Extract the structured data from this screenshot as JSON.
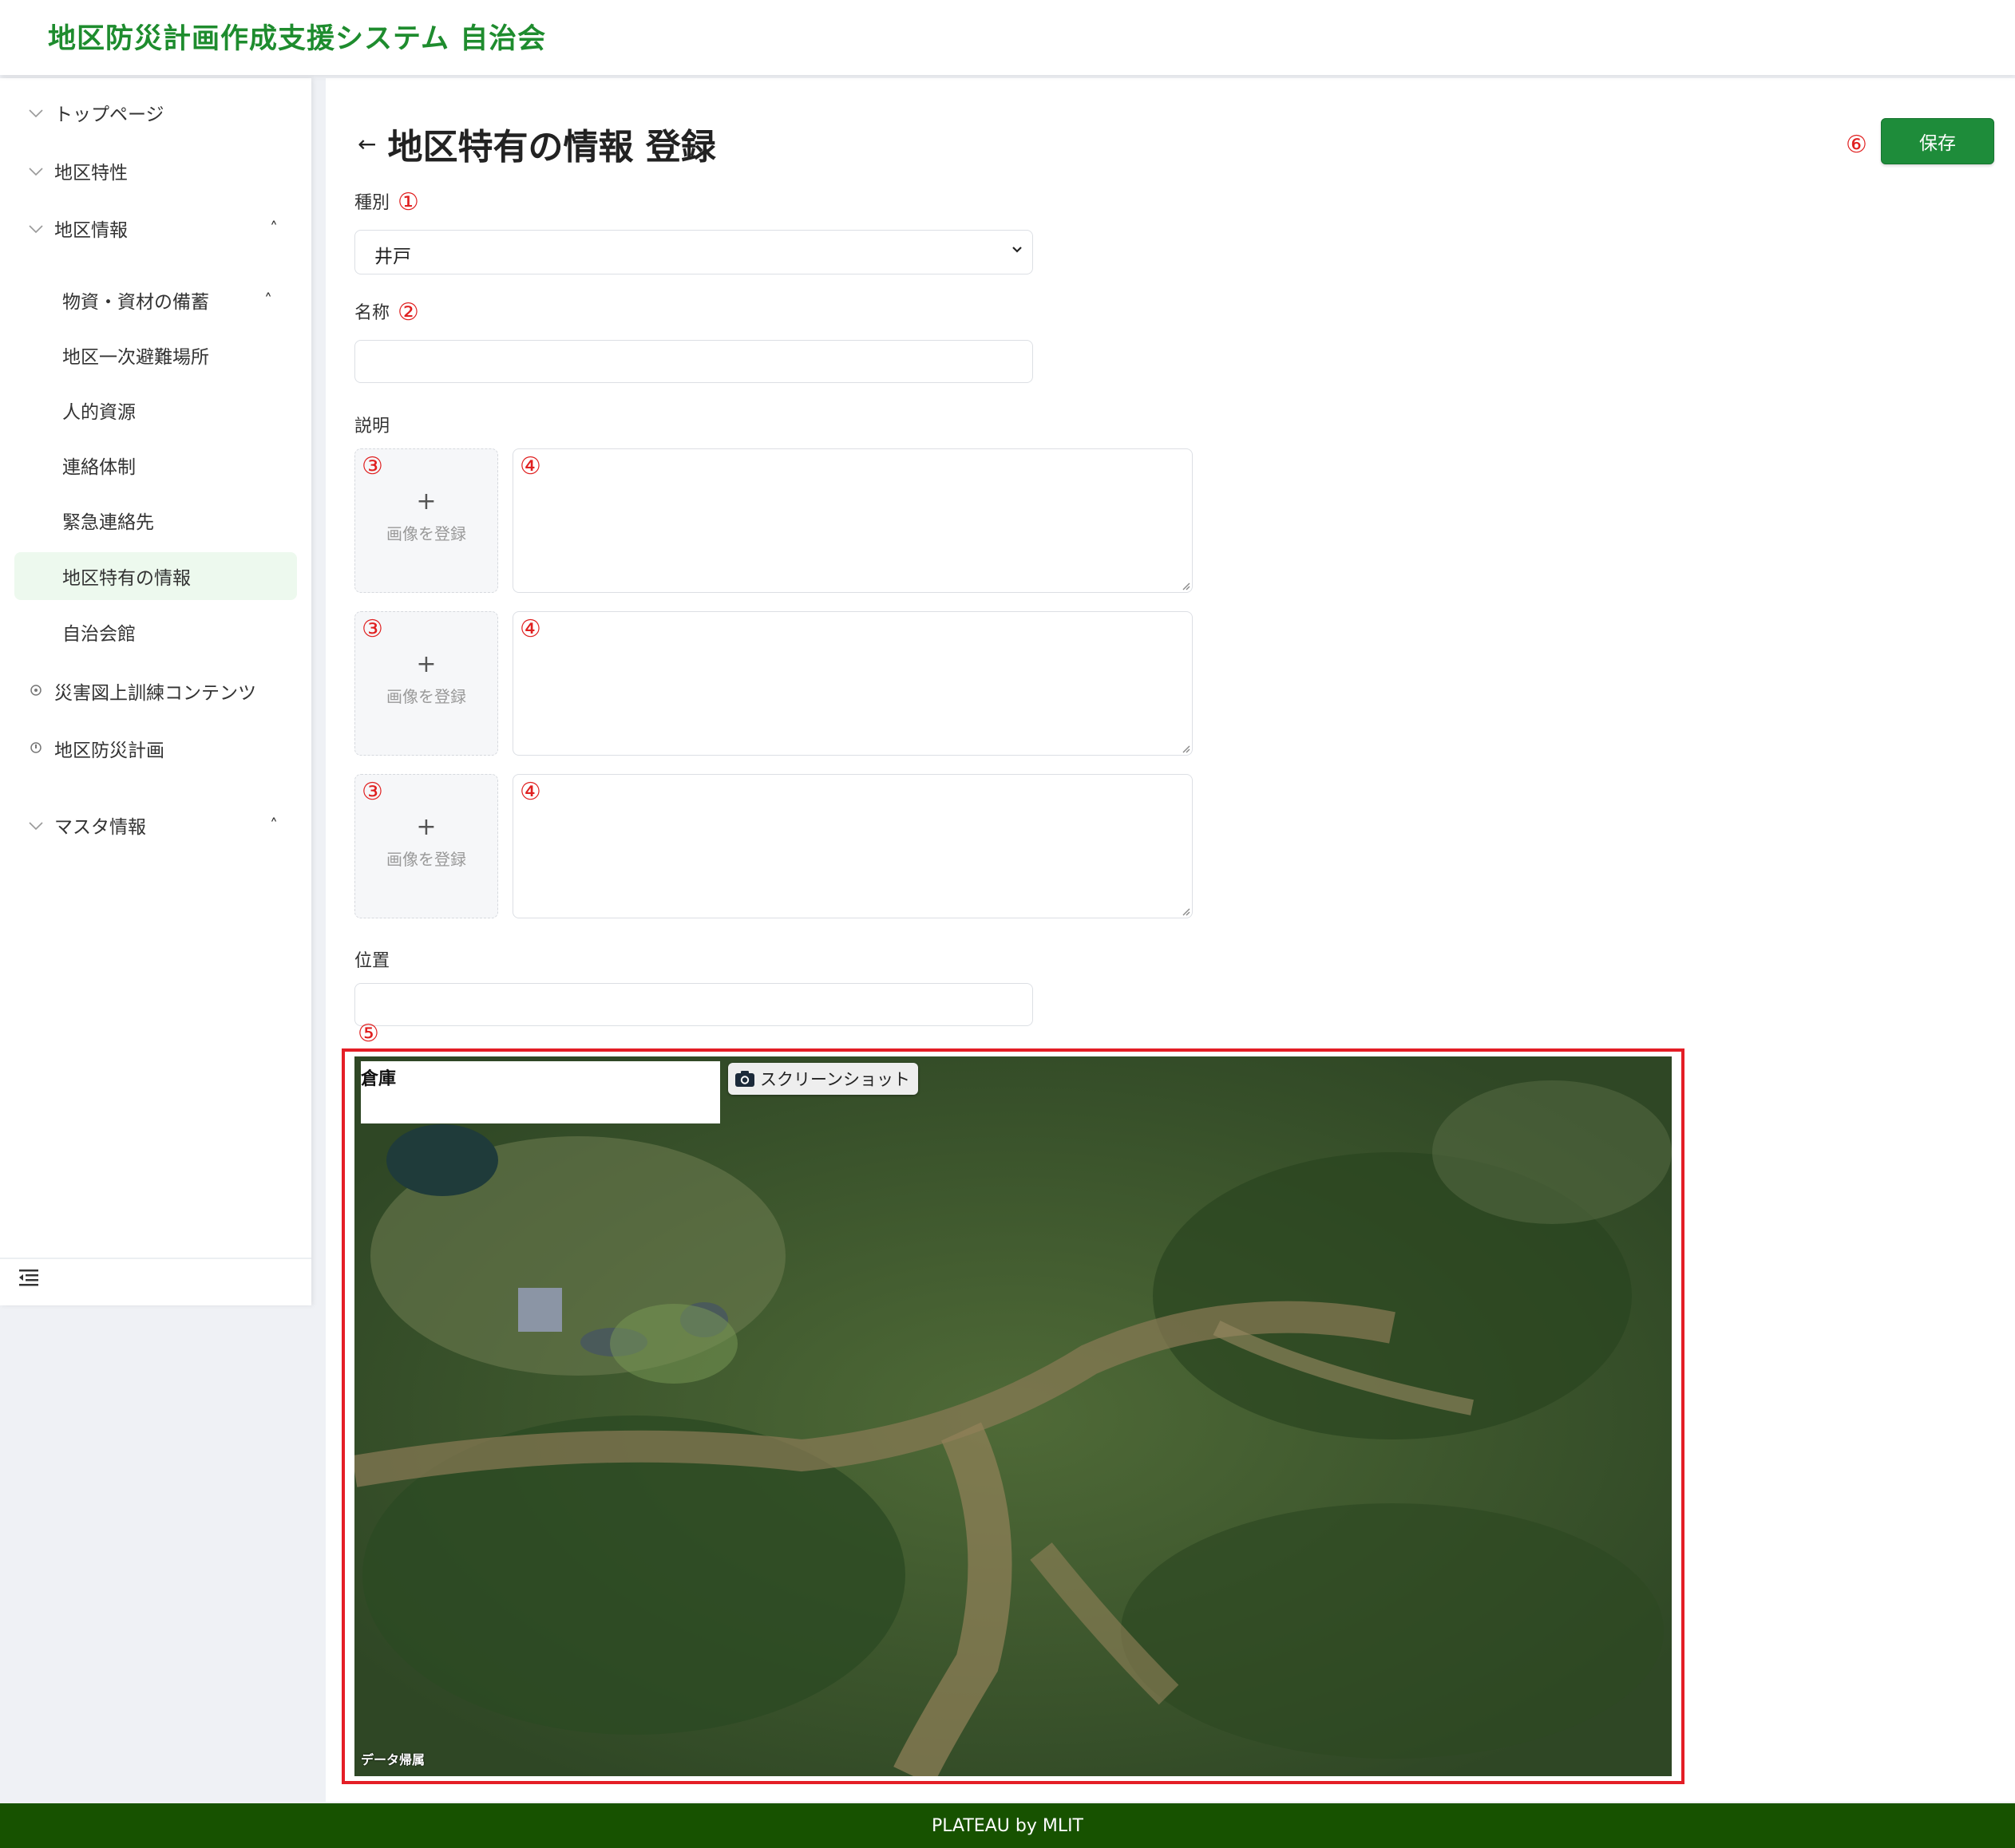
{
  "header": {
    "title": "地区防災計画作成支援システム 自治会"
  },
  "sidebar": {
    "items": [
      {
        "label": "トップページ",
        "icon": "chevron-down-icon"
      },
      {
        "label": "地区特性",
        "icon": "chevron-down-icon"
      },
      {
        "label": "地区情報",
        "icon": "chevron-down-icon",
        "expanded": true
      },
      {
        "label": "災害図上訓練コンテンツ",
        "icon": "circle-icon"
      },
      {
        "label": "地区防災計画",
        "icon": "circle-icon"
      },
      {
        "label": "マスタ情報",
        "icon": "chevron-down-icon",
        "expanded": true
      }
    ],
    "sub_items": [
      {
        "label": "物資・資材の備蓄",
        "expanded": true
      },
      {
        "label": "地区一次避難場所"
      },
      {
        "label": "人的資源"
      },
      {
        "label": "連絡体制"
      },
      {
        "label": "緊急連絡先"
      },
      {
        "label": "地区特有の情報",
        "active": true
      },
      {
        "label": "自治会館"
      }
    ],
    "caret_glyph": "˄",
    "collapse_icon": "menu-collapse-icon"
  },
  "page": {
    "title": "地区特有の情報 登録",
    "back_glyph": "←",
    "save_label": "保存",
    "markers": {
      "type": "①",
      "name": "②",
      "image": "③",
      "description": "④",
      "map": "⑤",
      "save": "⑥"
    }
  },
  "form": {
    "type_label": "種別",
    "type_value": "井戸",
    "select_chevron": "⌄",
    "name_label": "名称",
    "name_value": "",
    "description_label": "説明",
    "image_blocks": [
      {
        "plus": "+",
        "label": "画像を登録",
        "text": ""
      },
      {
        "plus": "+",
        "label": "画像を登録",
        "text": ""
      },
      {
        "plus": "+",
        "label": "画像を登録",
        "text": ""
      }
    ],
    "location_label": "位置",
    "location_value": ""
  },
  "map": {
    "label_title": "倉庫",
    "screenshot_label": "スクリーンショット",
    "screenshot_icon": "camera-icon",
    "attribution": "データ帰属"
  },
  "footer": {
    "text": "PLATEAU by MLIT"
  },
  "colors": {
    "brand": "#1e8c2e",
    "save": "#1e8c3a",
    "footer": "#175200",
    "highlight": "#e41e26"
  }
}
